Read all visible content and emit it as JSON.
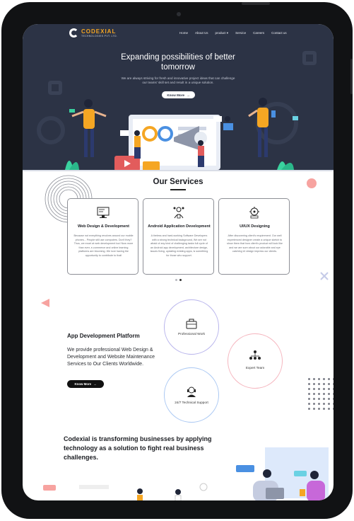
{
  "brand": {
    "name": "CODEXIAL",
    "tagline": "TECHNOLOGIES PVT. LTD.",
    "accent": "#f5a623",
    "hero_bg": "#2c3345"
  },
  "nav": {
    "items": [
      "Home",
      "About Us",
      "product",
      "Service",
      "Careers",
      "Contact us"
    ]
  },
  "hero": {
    "title": "Expanding possibilities of better tomorrow",
    "subtitle": "We are always striving for fresh and innovative project ideas that can challenge our teams' skill set and result in a unique solution.",
    "button_label": "Know More"
  },
  "services": {
    "title": "Our Services",
    "cards": [
      {
        "icon": "web-design-icon",
        "title": "Web Design & Development",
        "desc": "Because not everything revolves around our mobile phones... People still use computers. Don't they? Thus, we excel at web development too! Now more than ever, e-commerce and online learning platforms are blooming. We love having the opportunity to contribute to that!"
      },
      {
        "icon": "android-dev-icon",
        "title": "Android Application Development",
        "desc": "A tireless and hard-working Software Developers with a strong technical background, We are not afraid of any kind of challenging tasks full cycle of an Android app development, architecture design, issues fixing, updating existing apps, is something for those who support."
      },
      {
        "icon": "ui-ux-icon",
        "title": "UI/UX Designing",
        "desc": "After discovering client's requirement. Our well experienced designer create a unique sketch to show them that how client's product will look like and we are sure about our adorable and eye catching UI design impress our clients."
      }
    ]
  },
  "app_dev": {
    "title": "App Development Platform",
    "desc": "We provide professional Web Design & Development and Website Maintenance Services to Our Clients Worldwide.",
    "button_label": "Know More",
    "features": [
      {
        "label": "Professional Work",
        "icon": "briefcase-icon",
        "color": "#b8b4ec"
      },
      {
        "label": "Expert Team",
        "icon": "team-hierarchy-icon",
        "color": "#f5b5be"
      },
      {
        "label": "24/7 Technical Support",
        "icon": "support-agent-icon",
        "color": "#aac8f3"
      }
    ]
  },
  "transform": {
    "text": "Codexial is transforming businesses by applying technology as a solution to fight real business challenges."
  }
}
